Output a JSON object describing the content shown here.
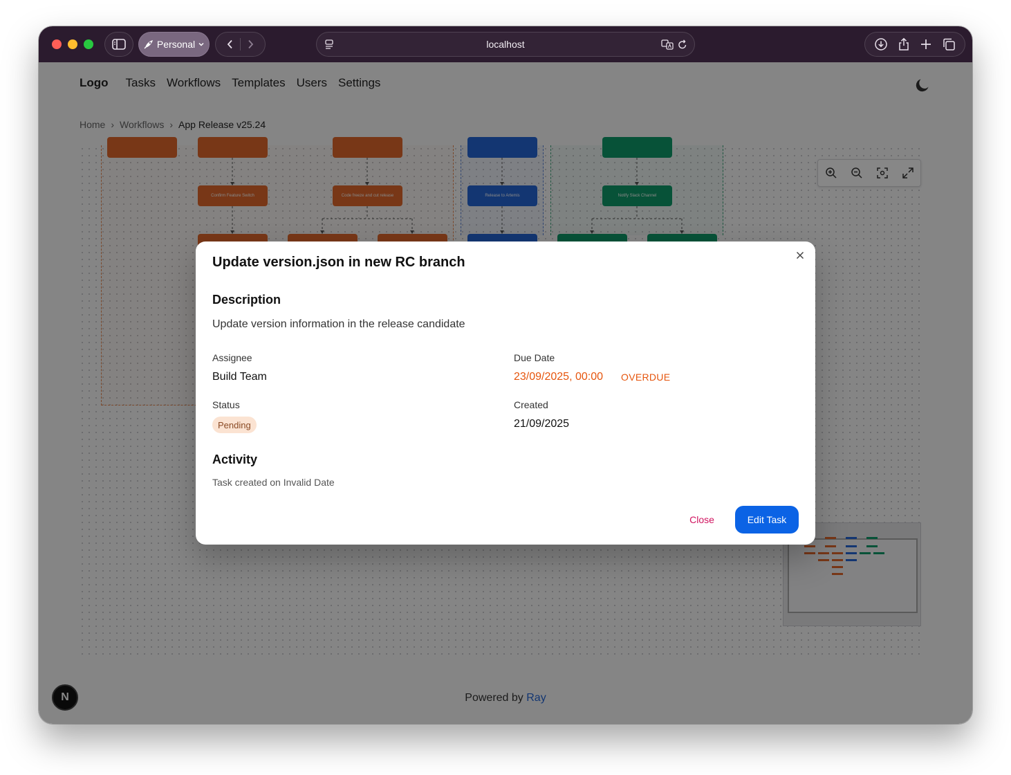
{
  "browser": {
    "profile_label": "Personal",
    "url": "localhost"
  },
  "nav": {
    "logo": "Logo",
    "items": [
      "Tasks",
      "Workflows",
      "Templates",
      "Users",
      "Settings"
    ]
  },
  "breadcrumb": {
    "items": [
      "Home",
      "Workflows"
    ],
    "current": "App Release v25.24"
  },
  "workflow": {
    "nodes": [
      "Confirm Feature Switch",
      "Code freeze and cut release",
      "Release to Artemis",
      "Notify Slack Channel"
    ]
  },
  "modal": {
    "title": "Update version.json in new RC branch",
    "description_heading": "Description",
    "description": "Update version information in the release candidate",
    "assignee_label": "Assignee",
    "assignee": "Build Team",
    "due_label": "Due Date",
    "due_value": "23/09/2025, 00:00",
    "overdue_badge": "OVERDUE",
    "status_label": "Status",
    "status_value": "Pending",
    "created_label": "Created",
    "created_value": "21/09/2025",
    "activity_heading": "Activity",
    "activity_text": "Task created on Invalid Date",
    "close_label": "Close",
    "edit_label": "Edit Task"
  },
  "footer": {
    "prefix": "Powered by",
    "brand": "Ray"
  },
  "badge": {
    "letter": "N"
  },
  "colors": {
    "orange_node": "#e2692c",
    "blue_node": "#2566d8",
    "green_node": "#0f9c6a",
    "overdue": "#e6550d",
    "primary_button": "#0b63e5",
    "close_button_text": "#d0125e",
    "status_chip_bg": "#fbe3d2"
  }
}
